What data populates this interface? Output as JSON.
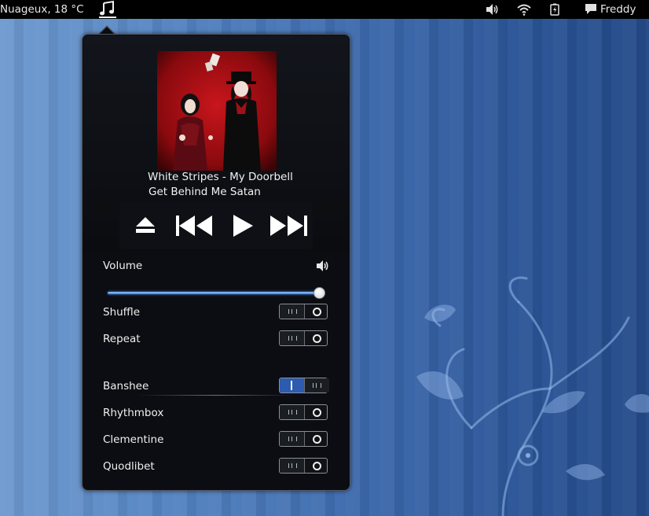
{
  "topbar": {
    "weather": "Nuageux, 18 °C",
    "music_icon": "music-note-icon",
    "volume_icon": "speaker-icon",
    "wifi_icon": "wifi-icon",
    "battery_icon": "battery-icon",
    "chat_icon": "chat-bubble-icon",
    "user": "Freddy"
  },
  "player": {
    "album_art": "album-cover-image",
    "track_title": "White Stripes - My Doorbell",
    "album": "Get Behind Me Satan",
    "controls": [
      "eject-icon",
      "previous-icon",
      "play-icon",
      "next-icon"
    ]
  },
  "settings": {
    "volume_label": "Volume",
    "volume_level": 1.0,
    "shuffle_label": "Shuffle",
    "shuffle_on": false,
    "repeat_label": "Repeat",
    "repeat_on": false
  },
  "players": [
    {
      "label": "Banshee",
      "active": true
    },
    {
      "label": "Rhythmbox",
      "active": false
    },
    {
      "label": "Clementine",
      "active": false
    },
    {
      "label": "Quodlibet",
      "active": false
    }
  ],
  "colors": {
    "accent": "#2c5bb0",
    "popup_bg": "#0b0d12",
    "topbar_bg": "#000000",
    "slider_fill": "#5aa0f0"
  }
}
